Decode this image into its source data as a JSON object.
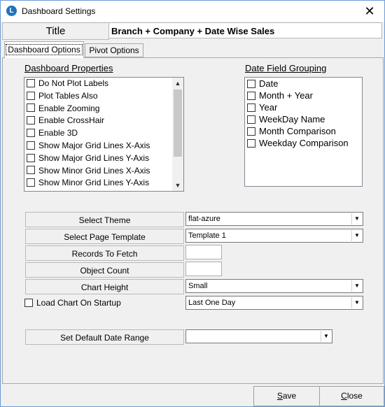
{
  "window": {
    "title": "Dashboard Settings",
    "close_symbol": "✕",
    "app_icon_glyph": "L"
  },
  "title_row": {
    "label": "Title",
    "value": "Branch + Company + Date Wise Sales"
  },
  "tabs": [
    {
      "label": "Dashboard Options",
      "active": true
    },
    {
      "label": "Pivot Options",
      "active": false
    }
  ],
  "dashboard_properties": {
    "heading": "Dashboard Properties",
    "items": [
      {
        "label": "Do Not Plot Labels",
        "checked": false
      },
      {
        "label": "Plot Tables Also",
        "checked": false
      },
      {
        "label": "Enable Zooming",
        "checked": false
      },
      {
        "label": "Enable CrossHair",
        "checked": false
      },
      {
        "label": "Enable 3D",
        "checked": false
      },
      {
        "label": "Show Major Grid Lines X-Axis",
        "checked": false
      },
      {
        "label": "Show Major Grid Lines Y-Axis",
        "checked": false
      },
      {
        "label": "Show Minor Grid Lines X-Axis",
        "checked": false
      },
      {
        "label": "Show Minor Grid Lines Y-Axis",
        "checked": false
      }
    ],
    "scroll_up": "▲",
    "scroll_down": "▼"
  },
  "date_field_grouping": {
    "heading": "Date Field Grouping",
    "items": [
      {
        "label": "Date",
        "checked": false
      },
      {
        "label": "Month + Year",
        "checked": false
      },
      {
        "label": "Year",
        "checked": false
      },
      {
        "label": "WeekDay Name",
        "checked": false
      },
      {
        "label": "Month Comparison",
        "checked": false
      },
      {
        "label": "Weekday Comparison",
        "checked": false
      }
    ]
  },
  "form": {
    "select_theme": {
      "label": "Select Theme",
      "value": "flat-azure"
    },
    "select_page_template": {
      "label": "Select Page Template",
      "value": "Template 1"
    },
    "records_to_fetch": {
      "label": "Records To Fetch",
      "value": ""
    },
    "object_count": {
      "label": "Object Count",
      "value": ""
    },
    "chart_height": {
      "label": "Chart Height",
      "value": "Small"
    },
    "load_chart_on_startup": {
      "label": "Load Chart On Startup",
      "checked": false,
      "value": "Last One Day"
    },
    "set_default_date_range": {
      "label": "Set Default Date Range",
      "value": ""
    },
    "dropdown_arrow": "▼"
  },
  "buttons": {
    "save_mnemonic": "S",
    "save_rest": "ave",
    "close_mnemonic": "C",
    "close_rest": "lose"
  }
}
